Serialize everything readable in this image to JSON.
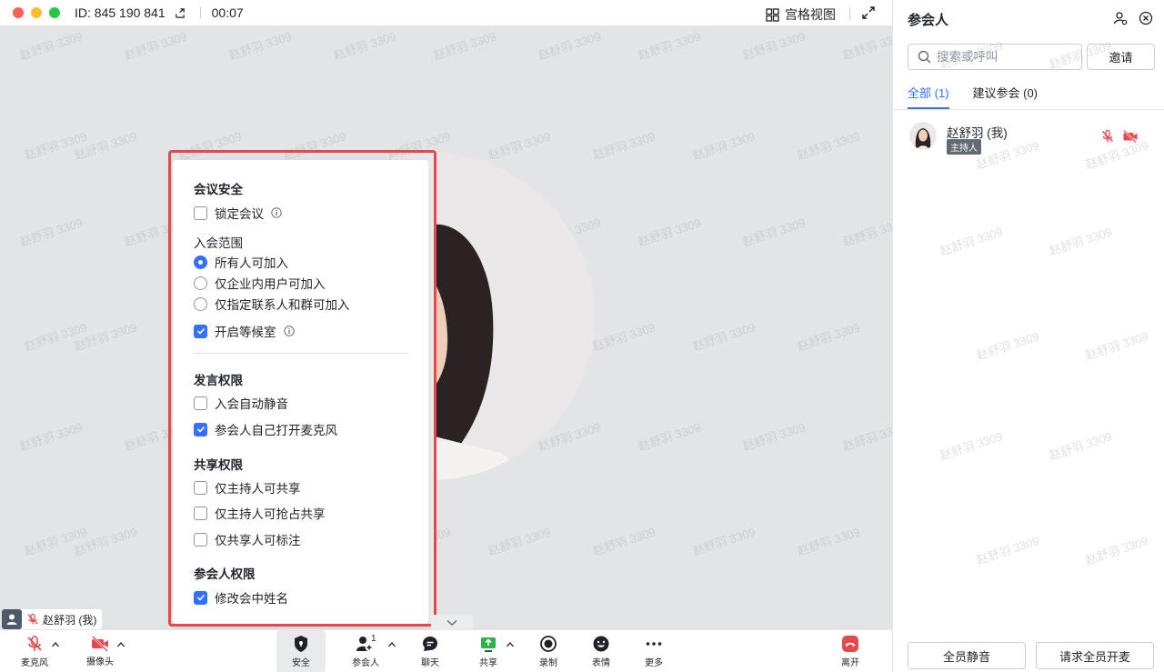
{
  "titlebar": {
    "meeting_id": "ID: 845 190 841",
    "timer": "00:07",
    "grid_view_label": "宫格视图"
  },
  "watermark": "赵舒羽 3309",
  "security_panel": {
    "meeting_security_heading": "会议安全",
    "lock_meeting": {
      "label": "锁定会议",
      "checked": false
    },
    "join_scope_heading": "入会范围",
    "join_scope_options": [
      {
        "label": "所有人可加入",
        "selected": true
      },
      {
        "label": "仅企业内用户可加入",
        "selected": false
      },
      {
        "label": "仅指定联系人和群可加入",
        "selected": false
      }
    ],
    "waiting_room": {
      "label": "开启等候室",
      "checked": true
    },
    "speak_heading": "发言权限",
    "speak_options": [
      {
        "label": "入会自动静音",
        "checked": false
      },
      {
        "label": "参会人自己打开麦克风",
        "checked": true
      }
    ],
    "share_heading": "共享权限",
    "share_options": [
      {
        "label": "仅主持人可共享",
        "checked": false
      },
      {
        "label": "仅主持人可抢占共享",
        "checked": false
      },
      {
        "label": "仅共享人可标注",
        "checked": false
      }
    ],
    "participant_heading": "参会人权限",
    "participant_options": [
      {
        "label": "修改会中姓名",
        "checked": true
      }
    ]
  },
  "self_tag": {
    "name": "赵舒羽 (我)"
  },
  "toolbar": {
    "mic": "麦克风",
    "camera": "摄像头",
    "security": "安全",
    "participants": "参会人",
    "participants_count": "1",
    "chat": "聊天",
    "share": "共享",
    "record": "录制",
    "reactions": "表情",
    "more": "更多",
    "leave": "离开"
  },
  "side_panel": {
    "title": "参会人",
    "search_placeholder": "搜索或呼叫",
    "invite": "邀请",
    "tabs": [
      {
        "label": "全部 (1)",
        "active": true
      },
      {
        "label": "建议参会 (0)",
        "active": false
      }
    ],
    "members": [
      {
        "name": "赵舒羽 (我)",
        "role": "主持人",
        "mic": "muted",
        "camera": "off"
      }
    ],
    "mute_all": "全员静音",
    "request_unmute_all": "请求全员开麦"
  },
  "colors": {
    "accent": "#3370ff",
    "danger": "#e5484d",
    "highlight_frame": "#e5484d"
  }
}
